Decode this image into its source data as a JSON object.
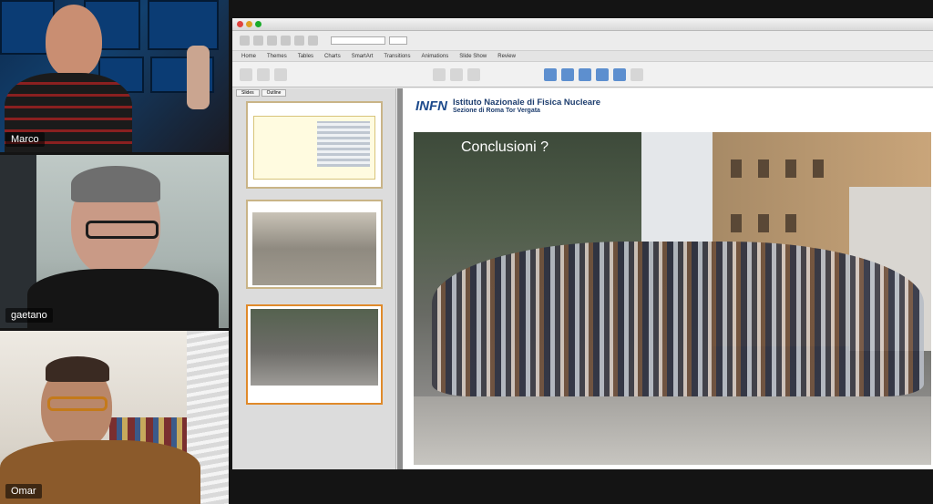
{
  "participants": [
    {
      "name": "Marco"
    },
    {
      "name": "gaetano"
    },
    {
      "name": "Omar"
    }
  ],
  "app": {
    "window_title": "",
    "ribbon_tabs": [
      "Home",
      "Themes",
      "Tables",
      "Charts",
      "SmartArt",
      "Transitions",
      "Animations",
      "Slide Show",
      "Review"
    ],
    "thumb_tabs": [
      "Slides",
      "Outline"
    ]
  },
  "slide": {
    "org_logo": "INFN",
    "org_name": "Istituto Nazionale di Fisica Nucleare",
    "org_section": "Sezione di Roma Tor Vergata",
    "title": "Conclusioni ?"
  },
  "thumbnails": [
    {
      "index": "",
      "caption": ""
    },
    {
      "index": "",
      "caption": ""
    },
    {
      "index": "",
      "caption": ""
    }
  ]
}
